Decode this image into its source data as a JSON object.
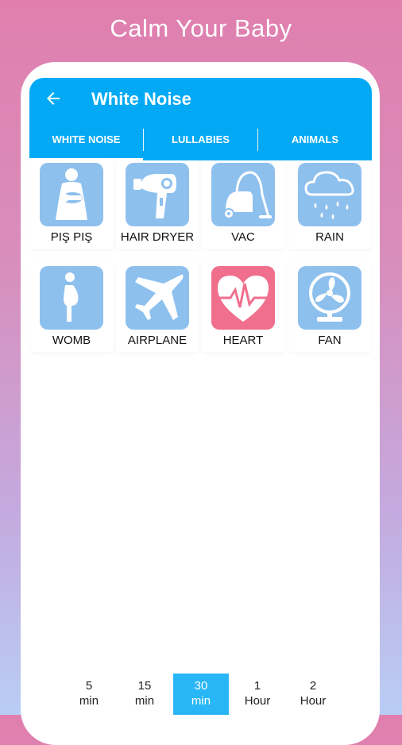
{
  "promo": {
    "title": "Calm Your Baby"
  },
  "appbar": {
    "title": "White Noise",
    "back_icon": "arrow-left-icon"
  },
  "tabs": [
    {
      "label": "WHITE NOISE",
      "selected": true
    },
    {
      "label": "LULLABIES",
      "selected": false
    },
    {
      "label": "ANIMALS",
      "selected": false
    }
  ],
  "sounds": [
    {
      "label": "PIŞ PIŞ",
      "icon": "mother-baby-icon",
      "color": "#8ec0ee"
    },
    {
      "label": "HAIR DRYER",
      "icon": "hair-dryer-icon",
      "color": "#8ec0ee"
    },
    {
      "label": "VAC",
      "icon": "vacuum-icon",
      "color": "#8ec0ee"
    },
    {
      "label": "RAIN",
      "icon": "rain-cloud-icon",
      "color": "#8ec0ee"
    },
    {
      "label": "WOMB",
      "icon": "pregnant-icon",
      "color": "#8ec0ee"
    },
    {
      "label": "AIRPLANE",
      "icon": "airplane-icon",
      "color": "#8ec0ee"
    },
    {
      "label": "HEART",
      "icon": "heartbeat-icon",
      "color": "#ef6f8c"
    },
    {
      "label": "FAN",
      "icon": "fan-icon",
      "color": "#8ec0ee"
    }
  ],
  "timer": [
    {
      "value": "5",
      "unit": "min",
      "selected": false
    },
    {
      "value": "15",
      "unit": "min",
      "selected": false
    },
    {
      "value": "30",
      "unit": "min",
      "selected": true
    },
    {
      "value": "1",
      "unit": "Hour",
      "selected": false
    },
    {
      "value": "2",
      "unit": "Hour",
      "selected": false
    }
  ],
  "colors": {
    "primary": "#03a9f4",
    "active_timer": "#29b6f6",
    "tile": "#8ec0ee",
    "heart_tile": "#ef6f8c"
  }
}
